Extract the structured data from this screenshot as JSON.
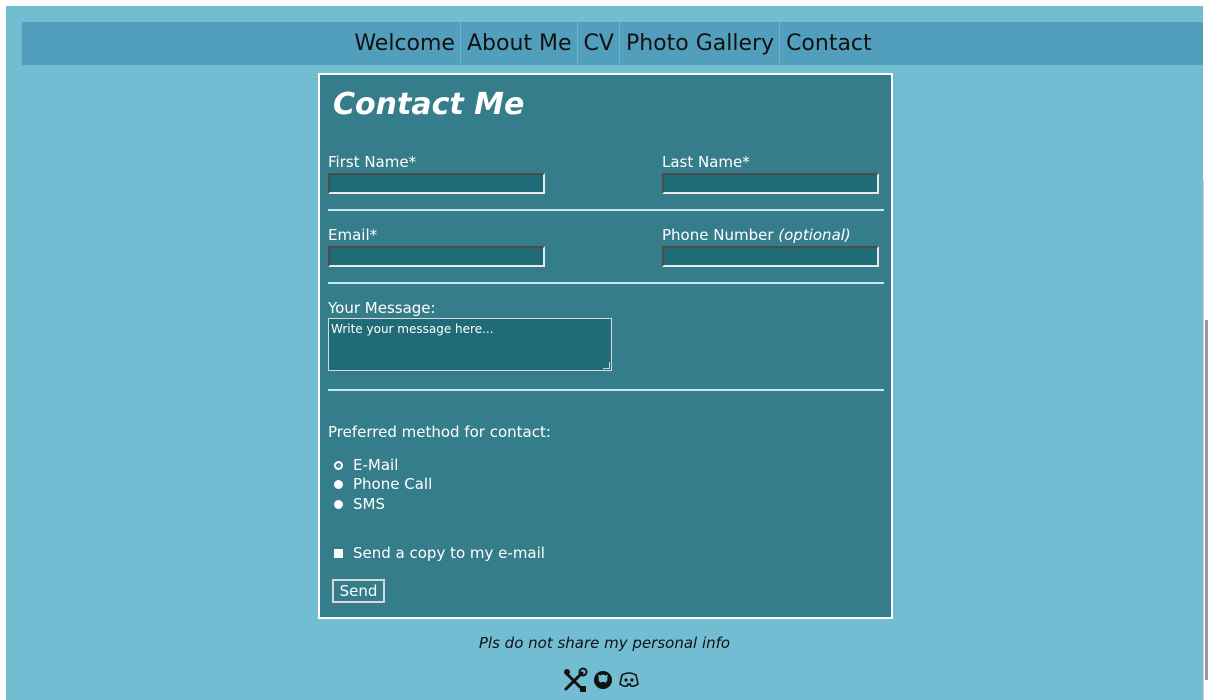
{
  "nav": {
    "items": [
      {
        "label": "Welcome"
      },
      {
        "label": "About Me"
      },
      {
        "label": "CV"
      },
      {
        "label": "Photo Gallery"
      },
      {
        "label": "Contact"
      }
    ]
  },
  "form": {
    "title": "Contact Me",
    "first_name_label": "First Name*",
    "last_name_label": "Last Name*",
    "email_label": "Email*",
    "phone_label": "Phone Number",
    "phone_optional": "(optional)",
    "message_label": "Your Message:",
    "message_placeholder": "Write your message here...",
    "contact_method_label": "Preferred method for contact:",
    "contact_options": [
      {
        "label": "E-Mail"
      },
      {
        "label": "Phone Call"
      },
      {
        "label": "SMS"
      }
    ],
    "copy_checkbox_label": "Send a copy to my e-mail",
    "send_label": "Send"
  },
  "footer": {
    "note": "Pls do not share my personal info",
    "icons": [
      "tools-icon",
      "github-icon",
      "discord-icon"
    ]
  },
  "colors": {
    "page_bg": "#73bdd3",
    "nav_bg": "#529fbd",
    "card_bg": "#357d8a",
    "input_bg": "#1f6b78"
  }
}
